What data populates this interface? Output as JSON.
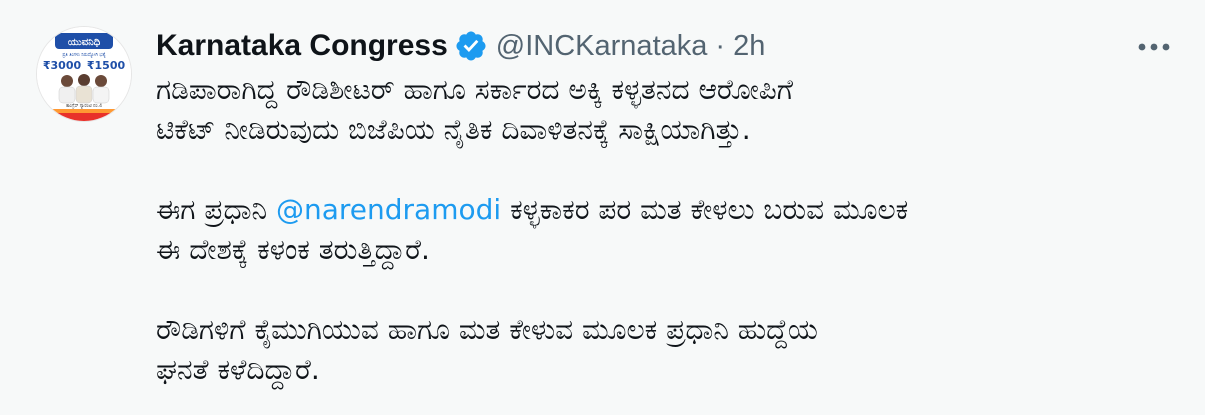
{
  "author": {
    "display_name": "Karnataka Congress",
    "handle": "@INCKarnataka",
    "separator": "·",
    "time": "2h",
    "verified_icon": "verified-badge-icon",
    "verified_color": "#1d9bf0"
  },
  "avatar": {
    "banner_text": "ಯುವನಿಧಿ",
    "small_text_1": "ಪ್ರತಿ ತಿಂಗಳು ನಿರುದ್ಯೋಗಿ ಭತ್ಯೆ",
    "amount_1": "₹3000",
    "amount_2": "₹1500",
    "footer_text": "ಕಾಂಗ್ರೆಸ್ ಗ್ಯಾರಂಟಿ ನಂ.4"
  },
  "menu": {
    "icon": "more-options-icon"
  },
  "tweet": {
    "mention": "@narendramodi",
    "para1": {
      "line1": "ಗಡಿಪಾರಾಗಿದ್ದ ರೌಡಿಶೀಟರ್ ಹಾಗೂ  ಸರ್ಕಾರದ ಅಕ್ಕಿ ಕಳ್ಳತನದ ಆರೋಪಿಗೆ",
      "line2": "ಟಿಕೆಟ್ ನೀಡಿರುವುದು ಬಿಜೆಪಿಯ ನೈತಿಕ ದಿವಾಳಿತನಕ್ಕೆ ಸಾಕ್ಷಿಯಾಗಿತ್ತು."
    },
    "para2": {
      "line1_before": "ಈಗ ಪ್ರಧಾನಿ ",
      "line1_after": " ಕಳ್ಳಕಾಕರ ಪರ ಮತ ಕೇಳಲು ಬರುವ ಮೂಲಕ",
      "line2": "ಈ ದೇಶಕ್ಕೆ ಕಳಂಕ ತರುತ್ತಿದ್ದಾರೆ."
    },
    "para3": {
      "line1": "ರೌಡಿಗಳಿಗೆ ಕೈಮುಗಿಯುವ ಹಾಗೂ ಮತ ಕೇಳುವ ಮೂಲಕ ಪ್ರಧಾನಿ ಹುದ್ದೆಯ",
      "line2": "ಘನತೆ ಕಳೆದಿದ್ದಾರೆ."
    }
  },
  "colors": {
    "background": "#f7f9f9",
    "text": "#0f1419",
    "secondary": "#536471",
    "link": "#1d9bf0"
  }
}
